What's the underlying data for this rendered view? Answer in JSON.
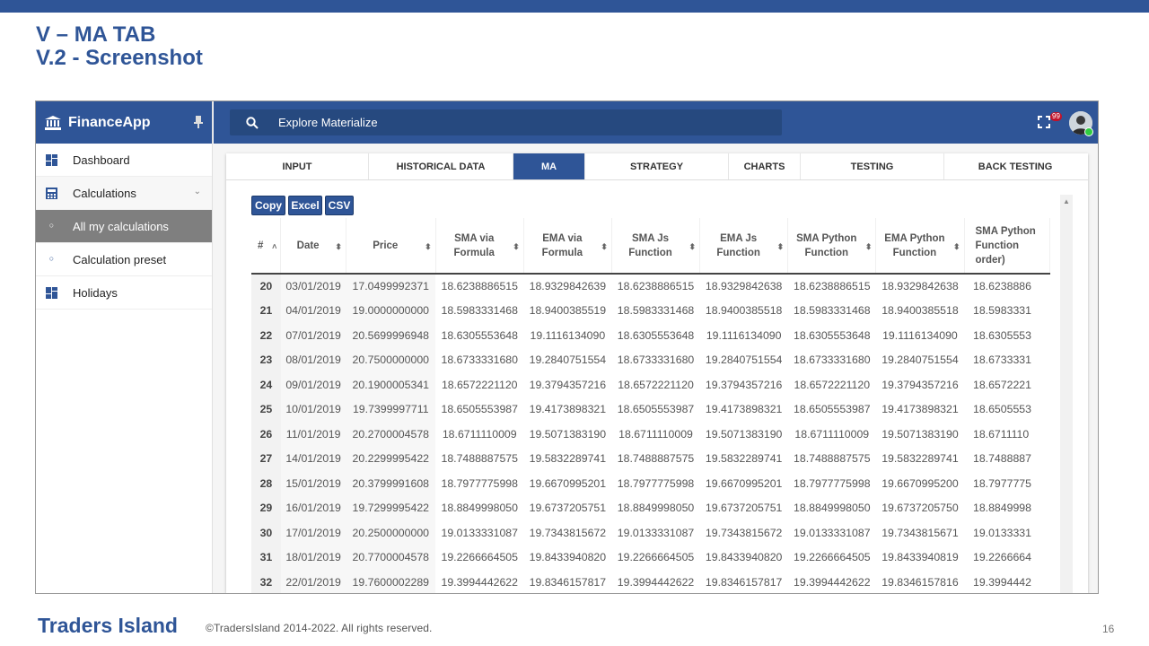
{
  "slide": {
    "title_line1": "V – MA TAB",
    "title_line2": "V.2 - Screenshot",
    "footer_brand": "Traders Island",
    "footer_copy": "©TradersIsland 2014-2022. All rights reserved.",
    "page_number": "16"
  },
  "app": {
    "name": "FinanceApp",
    "search_placeholder": "Explore Materialize",
    "notification_count": "99",
    "sidebar": [
      {
        "label": "Dashboard",
        "icon": "dashboard-icon"
      },
      {
        "label": "Calculations",
        "icon": "calculator-icon"
      },
      {
        "label": "All my calculations",
        "icon": "circle-icon"
      },
      {
        "label": "Calculation preset",
        "icon": "circle-icon"
      },
      {
        "label": "Holidays",
        "icon": "dashboard-icon"
      }
    ],
    "tabs": [
      "INPUT",
      "HISTORICAL DATA",
      "MA",
      "STRATEGY",
      "CHARTS",
      "TESTING",
      "BACK TESTING"
    ],
    "active_tab": "MA",
    "export_buttons": [
      "Copy",
      "Excel",
      "CSV"
    ],
    "columns": [
      "#",
      "Date",
      "Price",
      "SMA via Formula",
      "EMA via Formula",
      "SMA Js Function",
      "EMA Js Function",
      "SMA Python Function",
      "EMA Python Function",
      "SMA Python Function order)"
    ],
    "rows": [
      [
        "20",
        "03/01/2019",
        "17.0499992371",
        "18.6238886515",
        "18.9329842639",
        "18.6238886515",
        "18.9329842638",
        "18.6238886515",
        "18.9329842638",
        "18.6238886"
      ],
      [
        "21",
        "04/01/2019",
        "19.0000000000",
        "18.5983331468",
        "18.9400385519",
        "18.5983331468",
        "18.9400385518",
        "18.5983331468",
        "18.9400385518",
        "18.5983331"
      ],
      [
        "22",
        "07/01/2019",
        "20.5699996948",
        "18.6305553648",
        "19.1116134090",
        "18.6305553648",
        "19.1116134090",
        "18.6305553648",
        "19.1116134090",
        "18.6305553"
      ],
      [
        "23",
        "08/01/2019",
        "20.7500000000",
        "18.6733331680",
        "19.2840751554",
        "18.6733331680",
        "19.2840751554",
        "18.6733331680",
        "19.2840751554",
        "18.6733331"
      ],
      [
        "24",
        "09/01/2019",
        "20.1900005341",
        "18.6572221120",
        "19.3794357216",
        "18.6572221120",
        "19.3794357216",
        "18.6572221120",
        "19.3794357216",
        "18.6572221"
      ],
      [
        "25",
        "10/01/2019",
        "19.7399997711",
        "18.6505553987",
        "19.4173898321",
        "18.6505553987",
        "19.4173898321",
        "18.6505553987",
        "19.4173898321",
        "18.6505553"
      ],
      [
        "26",
        "11/01/2019",
        "20.2700004578",
        "18.6711110009",
        "19.5071383190",
        "18.6711110009",
        "19.5071383190",
        "18.6711110009",
        "19.5071383190",
        "18.6711110"
      ],
      [
        "27",
        "14/01/2019",
        "20.2299995422",
        "18.7488887575",
        "19.5832289741",
        "18.7488887575",
        "19.5832289741",
        "18.7488887575",
        "19.5832289741",
        "18.7488887"
      ],
      [
        "28",
        "15/01/2019",
        "20.3799991608",
        "18.7977775998",
        "19.6670995201",
        "18.7977775998",
        "19.6670995201",
        "18.7977775998",
        "19.6670995200",
        "18.7977775"
      ],
      [
        "29",
        "16/01/2019",
        "19.7299995422",
        "18.8849998050",
        "19.6737205751",
        "18.8849998050",
        "19.6737205751",
        "18.8849998050",
        "19.6737205750",
        "18.8849998"
      ],
      [
        "30",
        "17/01/2019",
        "20.2500000000",
        "19.0133331087",
        "19.7343815672",
        "19.0133331087",
        "19.7343815672",
        "19.0133331087",
        "19.7343815671",
        "19.0133331"
      ],
      [
        "31",
        "18/01/2019",
        "20.7700004578",
        "19.2266664505",
        "19.8433940820",
        "19.2266664505",
        "19.8433940820",
        "19.2266664505",
        "19.8433940819",
        "19.2266664"
      ],
      [
        "32",
        "22/01/2019",
        "19.7600002289",
        "19.3994442622",
        "19.8346157817",
        "19.3994442622",
        "19.8346157817",
        "19.3994442622",
        "19.8346157816",
        "19.3994442"
      ]
    ]
  }
}
